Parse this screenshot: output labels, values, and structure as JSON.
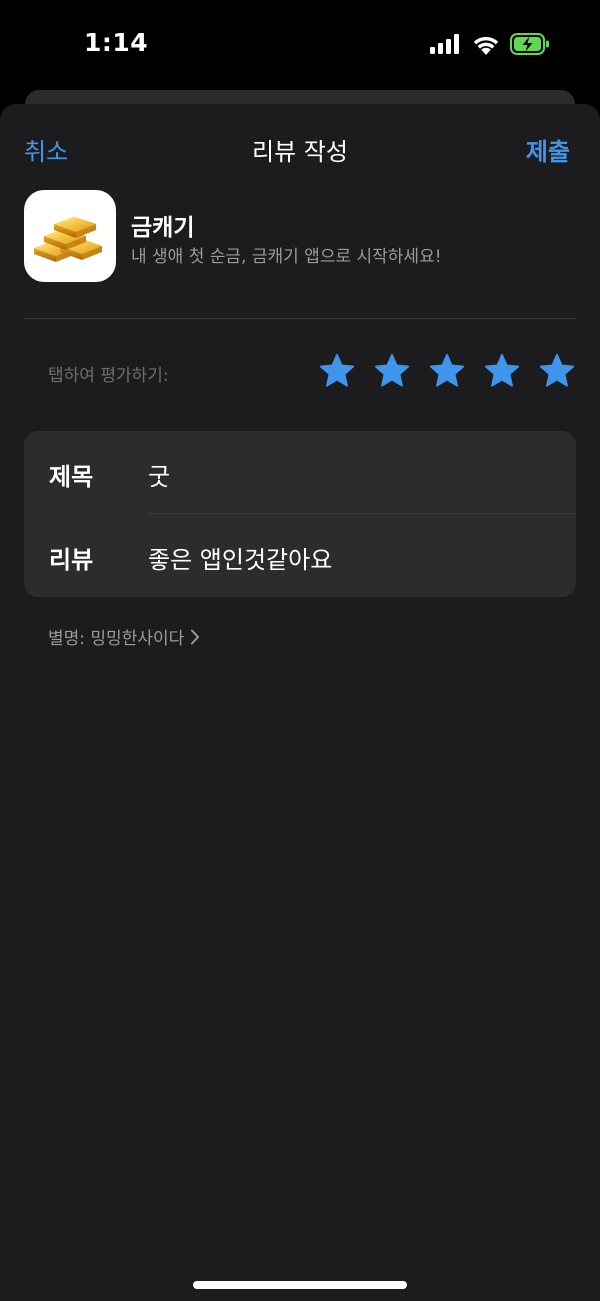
{
  "status_bar": {
    "time": "1:14",
    "icons": [
      "cellular-signal-icon",
      "wifi-icon",
      "battery-charging-icon"
    ],
    "battery_color": "#5fd94f"
  },
  "nav": {
    "cancel_label": "취소",
    "title": "리뷰 작성",
    "submit_label": "제출"
  },
  "app": {
    "name": "금캐기",
    "subtitle": "내 생애 첫 순금, 금캐기 앱으로 시작하세요!",
    "icon": "gold-bars-icon"
  },
  "rating": {
    "label": "탭하여 평가하기:",
    "value": 5,
    "max": 5,
    "star_color": "#3f95ec"
  },
  "form": {
    "title_label": "제목",
    "title_value": "굿",
    "review_label": "리뷰",
    "review_value": "좋은 앱인것같아요"
  },
  "nickname": {
    "text": "별명: 밍밍한사이다",
    "icon": "chevron-right-icon"
  },
  "colors": {
    "accent": "#3f95ec",
    "sheet_background": "#1c1c1e",
    "card_background": "#2c2c2e"
  }
}
